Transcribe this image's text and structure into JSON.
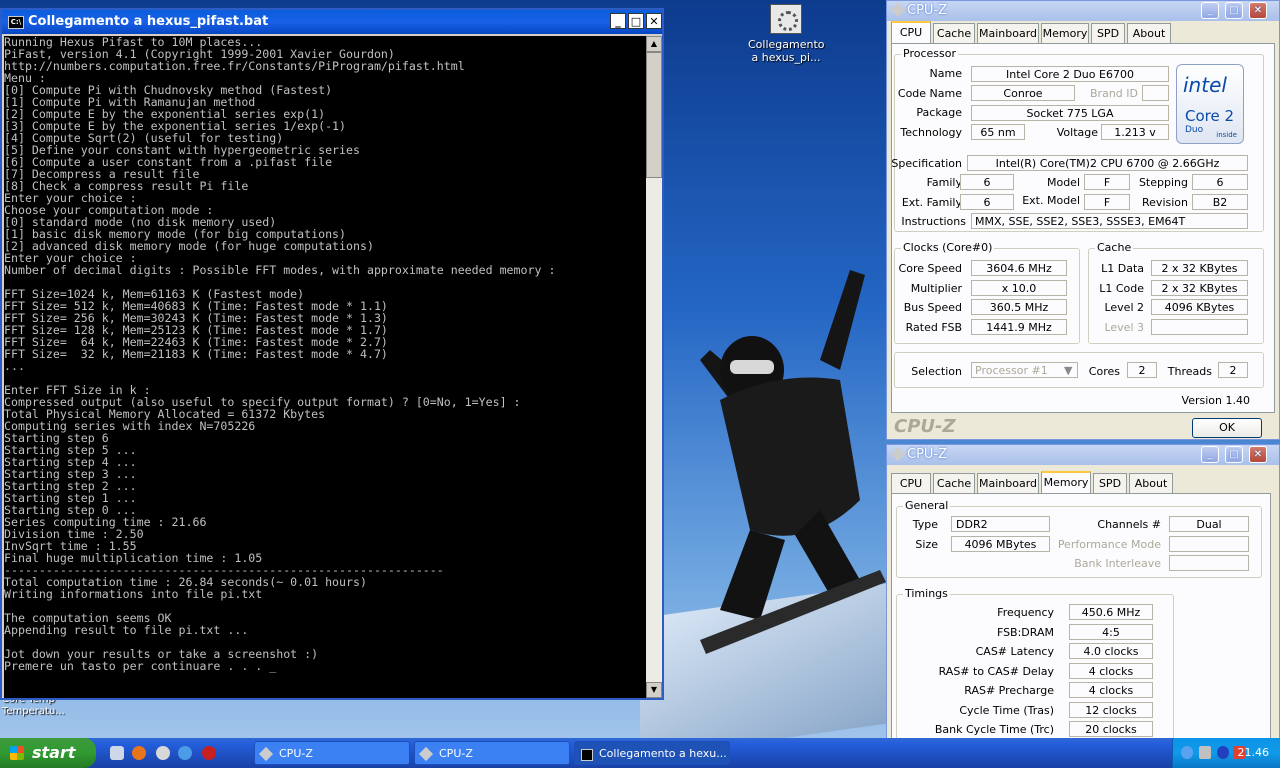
{
  "desktop": {
    "icon_label": "Collegamento a hexus_pi...",
    "under_label": "Core Temp\nTemperatu..."
  },
  "console": {
    "title": "Collegamento a hexus_pifast.bat",
    "icon_label": "C:\\",
    "lines": [
      "Running Hexus Pifast to 10M places...",
      "PiFast, version 4.1 (Copyright 1999-2001 Xavier Gourdon)",
      "http://numbers.computation.free.fr/Constants/PiProgram/pifast.html",
      "Menu :",
      "[0] Compute Pi with Chudnovsky method (Fastest)",
      "[1] Compute Pi with Ramanujan method",
      "[2] Compute E by the exponential series exp(1)",
      "[3] Compute E by the exponential series 1/exp(-1)",
      "[4] Compute Sqrt(2) (useful for testing)",
      "[5] Define your constant with hypergeometric series",
      "[6] Compute a user constant from a .pifast file",
      "[7] Decompress a result file",
      "[8] Check a compress result Pi file",
      "Enter your choice :",
      "Choose your computation mode :",
      "[0] standard mode (no disk memory used)",
      "[1] basic disk memory mode (for big computations)",
      "[2] advanced disk memory mode (for huge computations)",
      "Enter your choice :",
      "Number of decimal digits : Possible FFT modes, with approximate needed memory :",
      "",
      "FFT Size=1024 k, Mem=61163 K (Fastest mode)",
      "FFT Size= 512 k, Mem=40683 K (Time: Fastest mode * 1.1)",
      "FFT Size= 256 k, Mem=30243 K (Time: Fastest mode * 1.3)",
      "FFT Size= 128 k, Mem=25123 K (Time: Fastest mode * 1.7)",
      "FFT Size=  64 k, Mem=22463 K (Time: Fastest mode * 2.7)",
      "FFT Size=  32 k, Mem=21183 K (Time: Fastest mode * 4.7)",
      "...",
      "",
      "Enter FFT Size in k :",
      "Compressed output (also useful to specify output format) ? [0=No, 1=Yes] :",
      "Total Physical Memory Allocated = 61372 Kbytes",
      "Computing series with index N=705226",
      "Starting step 6",
      "Starting step 5 ...",
      "Starting step 4 ...",
      "Starting step 3 ...",
      "Starting step 2 ...",
      "Starting step 1 ...",
      "Starting step 0 ...",
      "Series computing time : 21.66",
      "Division time : 2.50",
      "InvSqrt time : 1.55",
      "Final huge multiplication time : 1.05",
      "---------------------------------------------------------------",
      "Total computation time : 26.84 seconds(~ 0.01 hours)",
      "Writing informations into file pi.txt",
      "",
      "The computation seems OK",
      "Appending result to file pi.txt ...",
      "",
      "Jot down your results or take a screenshot :)",
      "Premere un tasto per continuare . . . _"
    ]
  },
  "cpuz_main": {
    "title": "CPU-Z",
    "tabs": [
      "CPU",
      "Cache",
      "Mainboard",
      "Memory",
      "SPD",
      "About"
    ],
    "processor_group": "Processor",
    "name_label": "Name",
    "name": "Intel Core 2 Duo E6700",
    "codename_label": "Code Name",
    "codename": "Conroe",
    "brandid_label": "Brand ID",
    "brandid": "",
    "package_label": "Package",
    "package": "Socket 775 LGA",
    "technology_label": "Technology",
    "technology": "65 nm",
    "voltage_label": "Voltage",
    "voltage": "1.213 v",
    "spec_label": "Specification",
    "spec": "Intel(R) Core(TM)2 CPU        6700  @ 2.66GHz",
    "family_label": "Family",
    "family": "6",
    "model_label": "Model",
    "model": "F",
    "stepping_label": "Stepping",
    "stepping": "6",
    "extfamily_label": "Ext. Family",
    "extfamily": "6",
    "extmodel_label": "Ext. Model",
    "extmodel": "F",
    "revision_label": "Revision",
    "revision": "B2",
    "instr_label": "Instructions",
    "instr": "MMX, SSE, SSE2, SSE3, SSSE3, EM64T",
    "clocks_group": "Clocks (Core#0)",
    "corespeed_label": "Core Speed",
    "corespeed": "3604.6 MHz",
    "multiplier_label": "Multiplier",
    "multiplier": "x 10.0",
    "busspeed_label": "Bus Speed",
    "busspeed": "360.5 MHz",
    "ratedfsb_label": "Rated FSB",
    "ratedfsb": "1441.9 MHz",
    "cache_group": "Cache",
    "l1data_label": "L1 Data",
    "l1data": "2 x 32 KBytes",
    "l1code_label": "L1 Code",
    "l1code": "2 x 32 KBytes",
    "level2_label": "Level 2",
    "level2": "4096 KBytes",
    "level3_label": "Level 3",
    "level3": "",
    "selection_label": "Selection",
    "selection": "Processor #1",
    "cores_label": "Cores",
    "cores": "2",
    "threads_label": "Threads",
    "threads": "2",
    "version": "Version 1.40",
    "brand": "CPU-Z",
    "ok": "OK",
    "logo_intel": "intel",
    "logo_core2": "Core 2",
    "logo_duo": "Duo",
    "logo_inside": "inside"
  },
  "cpuz_mem": {
    "title": "CPU-Z",
    "tabs": [
      "CPU",
      "Cache",
      "Mainboard",
      "Memory",
      "SPD",
      "About"
    ],
    "general_group": "General",
    "type_label": "Type",
    "type": "DDR2",
    "size_label": "Size",
    "size": "4096 MBytes",
    "channels_label": "Channels #",
    "channels": "Dual",
    "perfmode_label": "Performance Mode",
    "perfmode": "",
    "bankinter_label": "Bank Interleave",
    "bankinter": "",
    "timings_group": "Timings",
    "freq_label": "Frequency",
    "freq": "450.6 MHz",
    "fsbdram_label": "FSB:DRAM",
    "fsbdram": "4:5",
    "cas_label": "CAS# Latency",
    "cas": "4.0 clocks",
    "rcd_label": "RAS# to CAS# Delay",
    "rcd": "4 clocks",
    "rp_label": "RAS# Precharge",
    "rp": "4 clocks",
    "tras_label": "Cycle Time (Tras)",
    "tras": "12 clocks",
    "trc_label": "Bank Cycle Time (Trc)",
    "trc": "20 clocks"
  },
  "taskbar": {
    "start": "start",
    "tasks": [
      "CPU-Z",
      "CPU-Z",
      "Collegamento a hexu..."
    ],
    "clock": "21.46"
  }
}
